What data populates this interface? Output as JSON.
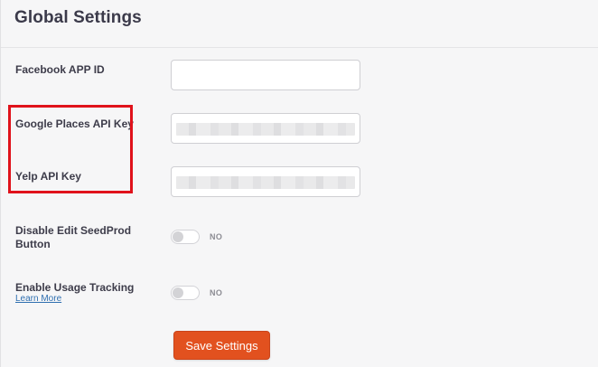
{
  "page": {
    "title": "Global Settings"
  },
  "fields": {
    "facebook_app_id": {
      "label": "Facebook APP ID",
      "value": ""
    },
    "google_places_api_key": {
      "label": "Google Places API Key",
      "value": ""
    },
    "yelp_api_key": {
      "label": "Yelp API Key",
      "value": ""
    }
  },
  "toggles": {
    "disable_edit_button": {
      "label": "Disable Edit SeedProd Button",
      "state": "NO",
      "enabled": false
    },
    "usage_tracking": {
      "label": "Enable Usage Tracking",
      "link": "Learn More",
      "state": "NO",
      "enabled": false
    }
  },
  "actions": {
    "save_label": "Save Settings"
  },
  "colors": {
    "accent": "#e2511f",
    "highlight": "#e0121b",
    "link": "#2f6fb0",
    "background": "#f6f6f7"
  }
}
